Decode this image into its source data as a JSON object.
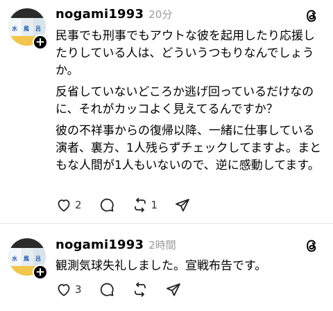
{
  "posts": [
    {
      "username": "nogami1993",
      "timestamp": "20分",
      "paragraphs": [
        "民事でも刑事でもアウトな彼を起用したり応援したりしている人は、どういうつもりなんでしょうか。",
        "反省していないどころか逃げ回っているだけなのに、それがカッコよく見えてるんですか？",
        "彼の不祥事からの復帰以降、一緒に仕事している演者、裏方、1人残らずチェックしてますよ。まともな人間が1人もいないので、逆に感動してます。"
      ],
      "likes": "2",
      "replies": "",
      "reposts": "1",
      "avatar_text": [
        "水",
        "風",
        "呂"
      ]
    },
    {
      "username": "nogami1993",
      "timestamp": "2時間",
      "paragraphs": [
        "観測気球失礼しました。宣戦布告です。"
      ],
      "likes": "3",
      "replies": "",
      "reposts": "",
      "avatar_text": [
        "水",
        "風",
        "呂"
      ]
    }
  ],
  "icons": {
    "like": "heart-icon",
    "reply": "comment-icon",
    "repost": "repost-icon",
    "share": "send-icon",
    "app": "threads-logo-icon",
    "follow": "plus-icon"
  }
}
